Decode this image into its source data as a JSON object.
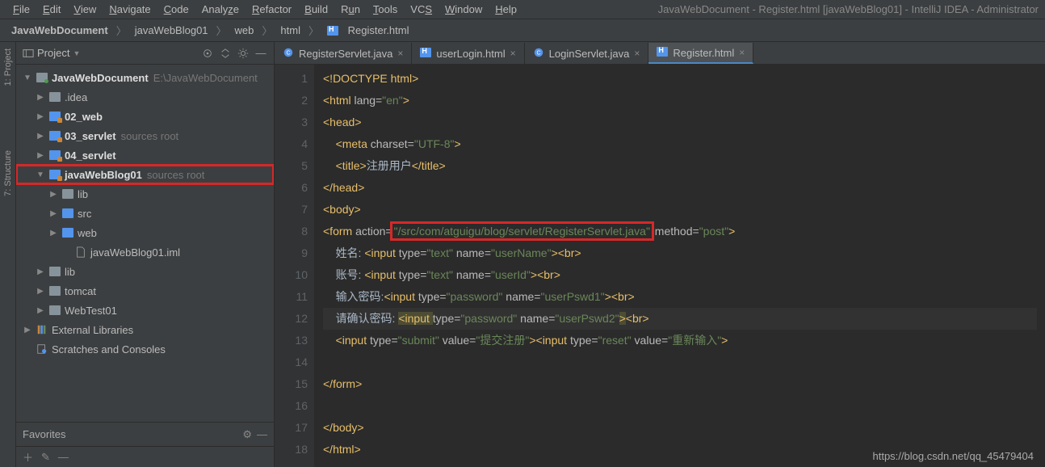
{
  "window_title": "JavaWebDocument - Register.html [javaWebBlog01] - IntelliJ IDEA - Administrator",
  "menu": [
    "File",
    "Edit",
    "View",
    "Navigate",
    "Code",
    "Analyze",
    "Refactor",
    "Build",
    "Run",
    "Tools",
    "VCS",
    "Window",
    "Help"
  ],
  "breadcrumb": [
    "JavaWebDocument",
    "javaWebBlog01",
    "web",
    "html",
    "Register.html"
  ],
  "panel": {
    "title": "Project"
  },
  "gutters": {
    "project": "1: Project",
    "structure": "7: Structure"
  },
  "tree": [
    {
      "depth": 0,
      "arrow": "▼",
      "icon": "proj",
      "label": "JavaWebDocument",
      "bold": true,
      "hint": "E:\\JavaWebDocument"
    },
    {
      "depth": 1,
      "arrow": "▶",
      "icon": "folder",
      "label": ".idea"
    },
    {
      "depth": 1,
      "arrow": "▶",
      "icon": "module",
      "label": "02_web",
      "bold": true
    },
    {
      "depth": 1,
      "arrow": "▶",
      "icon": "module",
      "label": "03_servlet",
      "bold": true,
      "hint": "sources root"
    },
    {
      "depth": 1,
      "arrow": "▶",
      "icon": "module",
      "label": "04_servlet",
      "bold": true
    },
    {
      "depth": 1,
      "arrow": "▼",
      "icon": "module",
      "label": "javaWebBlog01",
      "bold": true,
      "hint": "sources root",
      "highlight": true
    },
    {
      "depth": 2,
      "arrow": "▶",
      "icon": "folder",
      "label": "lib"
    },
    {
      "depth": 2,
      "arrow": "▶",
      "icon": "blue",
      "label": "src"
    },
    {
      "depth": 2,
      "arrow": "▶",
      "icon": "blue",
      "label": "web"
    },
    {
      "depth": 3,
      "arrow": "",
      "icon": "file",
      "label": "javaWebBlog01.iml"
    },
    {
      "depth": 1,
      "arrow": "▶",
      "icon": "folder",
      "label": "lib"
    },
    {
      "depth": 1,
      "arrow": "▶",
      "icon": "folder",
      "label": "tomcat"
    },
    {
      "depth": 1,
      "arrow": "▶",
      "icon": "folder",
      "label": "WebTest01"
    },
    {
      "depth": 0,
      "arrow": "▶",
      "icon": "libs",
      "label": "External Libraries"
    },
    {
      "depth": 0,
      "arrow": "",
      "icon": "scratch",
      "label": "Scratches and Consoles"
    }
  ],
  "favorites": "Favorites",
  "tabs": [
    {
      "name": "RegisterServlet.java",
      "icon": "java"
    },
    {
      "name": "userLogin.html",
      "icon": "html"
    },
    {
      "name": "LoginServlet.java",
      "icon": "java"
    },
    {
      "name": "Register.html",
      "icon": "html",
      "active": true
    }
  ],
  "code": {
    "line1": "<!DOCTYPE html>",
    "line2_open": "<html ",
    "line2_attr": "lang=",
    "line2_val": "\"en\"",
    "line2_close": ">",
    "line3": "<head>",
    "line4_open": "<meta ",
    "line4_attr": "charset=",
    "line4_val": "\"UTF-8\"",
    "line4_close": ">",
    "line5_open": "<title>",
    "line5_text": "注册用户",
    "line5_close": "</title>",
    "line6": "</head>",
    "line7": "<body>",
    "line8_open": "<form ",
    "line8_a1": "action=",
    "line8_v1": "\"/src/com/atguigu/blog/servlet/RegisterServlet.java\"",
    "line8_a2": " method=",
    "line8_v2": "\"post\"",
    "line8_close": ">",
    "line9_text": "姓名: ",
    "line9_open": "<input ",
    "line9_a1": "type=",
    "line9_v1": "\"text\"",
    "line9_a2": " name=",
    "line9_v2": "\"userName\"",
    "line9_close": ">",
    "line9_br": "<br>",
    "line10_text": "账号: ",
    "line10_open": "<input ",
    "line10_a1": "type=",
    "line10_v1": "\"text\"",
    "line10_a2": " name=",
    "line10_v2": "\"userId\"",
    "line10_close": ">",
    "line10_br": "<br>",
    "line11_text": "输入密码:",
    "line11_open": "<input ",
    "line11_a1": "type=",
    "line11_v1": "\"password\"",
    "line11_a2": " name=",
    "line11_v2": "\"userPswd1\"",
    "line11_close": ">",
    "line11_br": "<br>",
    "line12_text": "请确认密码: ",
    "line12_open": "<input ",
    "line12_a1": "type=",
    "line12_v1": "\"password\"",
    "line12_a2": " name=",
    "line12_v2": "\"userPswd2\"",
    "line12_close": ">",
    "line12_br": "<br>",
    "line13_open1": "<input ",
    "line13_a1": "type=",
    "line13_v1": "\"submit\"",
    "line13_a2": " value=",
    "line13_v2": "\"提交注册\"",
    "line13_close1": ">",
    "line13_open2": "<input ",
    "line13_a3": "type=",
    "line13_v3": "\"reset\"",
    "line13_a4": " value=",
    "line13_v4": "\"重新输入\"",
    "line13_close2": ">",
    "line15": "</form>",
    "line17": "</body>",
    "line18": "</html>"
  },
  "line_numbers": [
    "1",
    "2",
    "3",
    "4",
    "5",
    "6",
    "7",
    "8",
    "9",
    "10",
    "11",
    "12",
    "13",
    "14",
    "15",
    "16",
    "17",
    "18"
  ],
  "watermark": "https://blog.csdn.net/qq_45479404"
}
